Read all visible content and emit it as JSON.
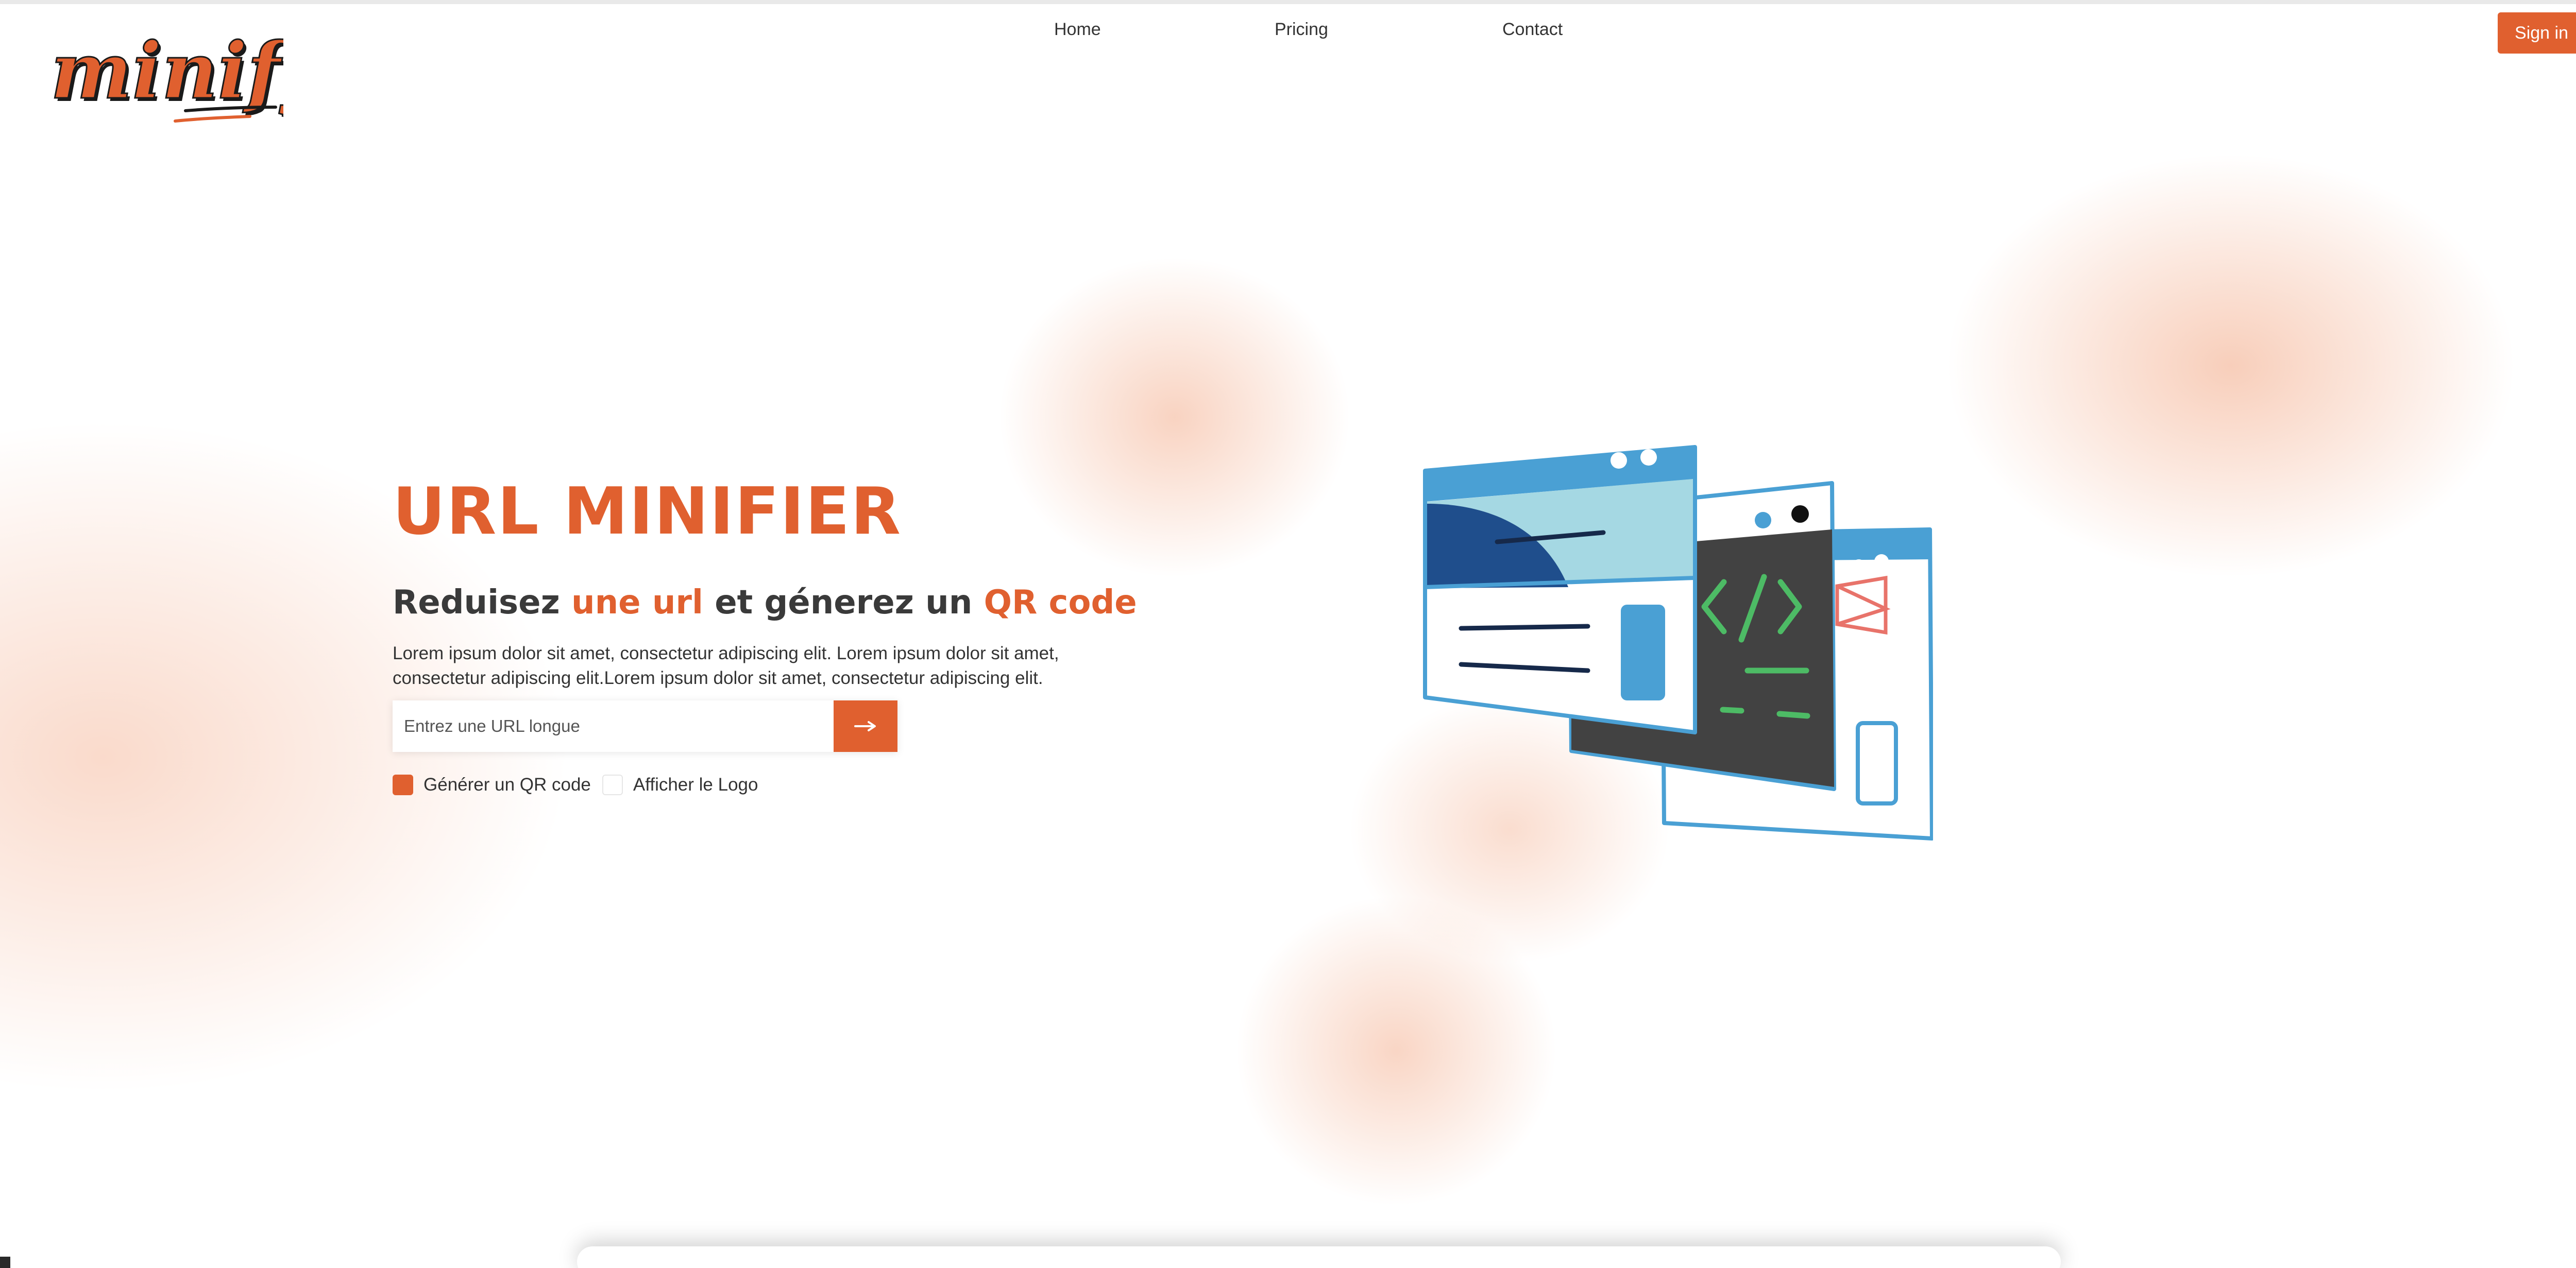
{
  "brand": {
    "logo_text": "minify",
    "accent_color": "#e0602f"
  },
  "nav": {
    "items": [
      {
        "label": "Home"
      },
      {
        "label": "Pricing"
      },
      {
        "label": "Contact"
      }
    ],
    "signin_label": "Sign in"
  },
  "hero": {
    "title": "URL MINIFIER",
    "subtitle_parts": [
      "Reduisez ",
      "une url",
      " et génerez un ",
      "QR code"
    ],
    "description": "Lorem ipsum dolor sit amet, consectetur adipiscing elit. Lorem ipsum dolor sit amet, consectetur adipiscing elit.Lorem ipsum dolor sit amet, consectetur adipiscing elit.",
    "url_input": {
      "value": "",
      "placeholder": "Entrez une URL longue"
    },
    "submit_icon": "arrow-right-icon",
    "options": [
      {
        "label": "Générer un QR code",
        "checked": true
      },
      {
        "label": "Afficher le Logo",
        "checked": false
      }
    ]
  },
  "illustration": {
    "icon": "browser-windows-code-illustration",
    "code_glyph": "</>"
  }
}
